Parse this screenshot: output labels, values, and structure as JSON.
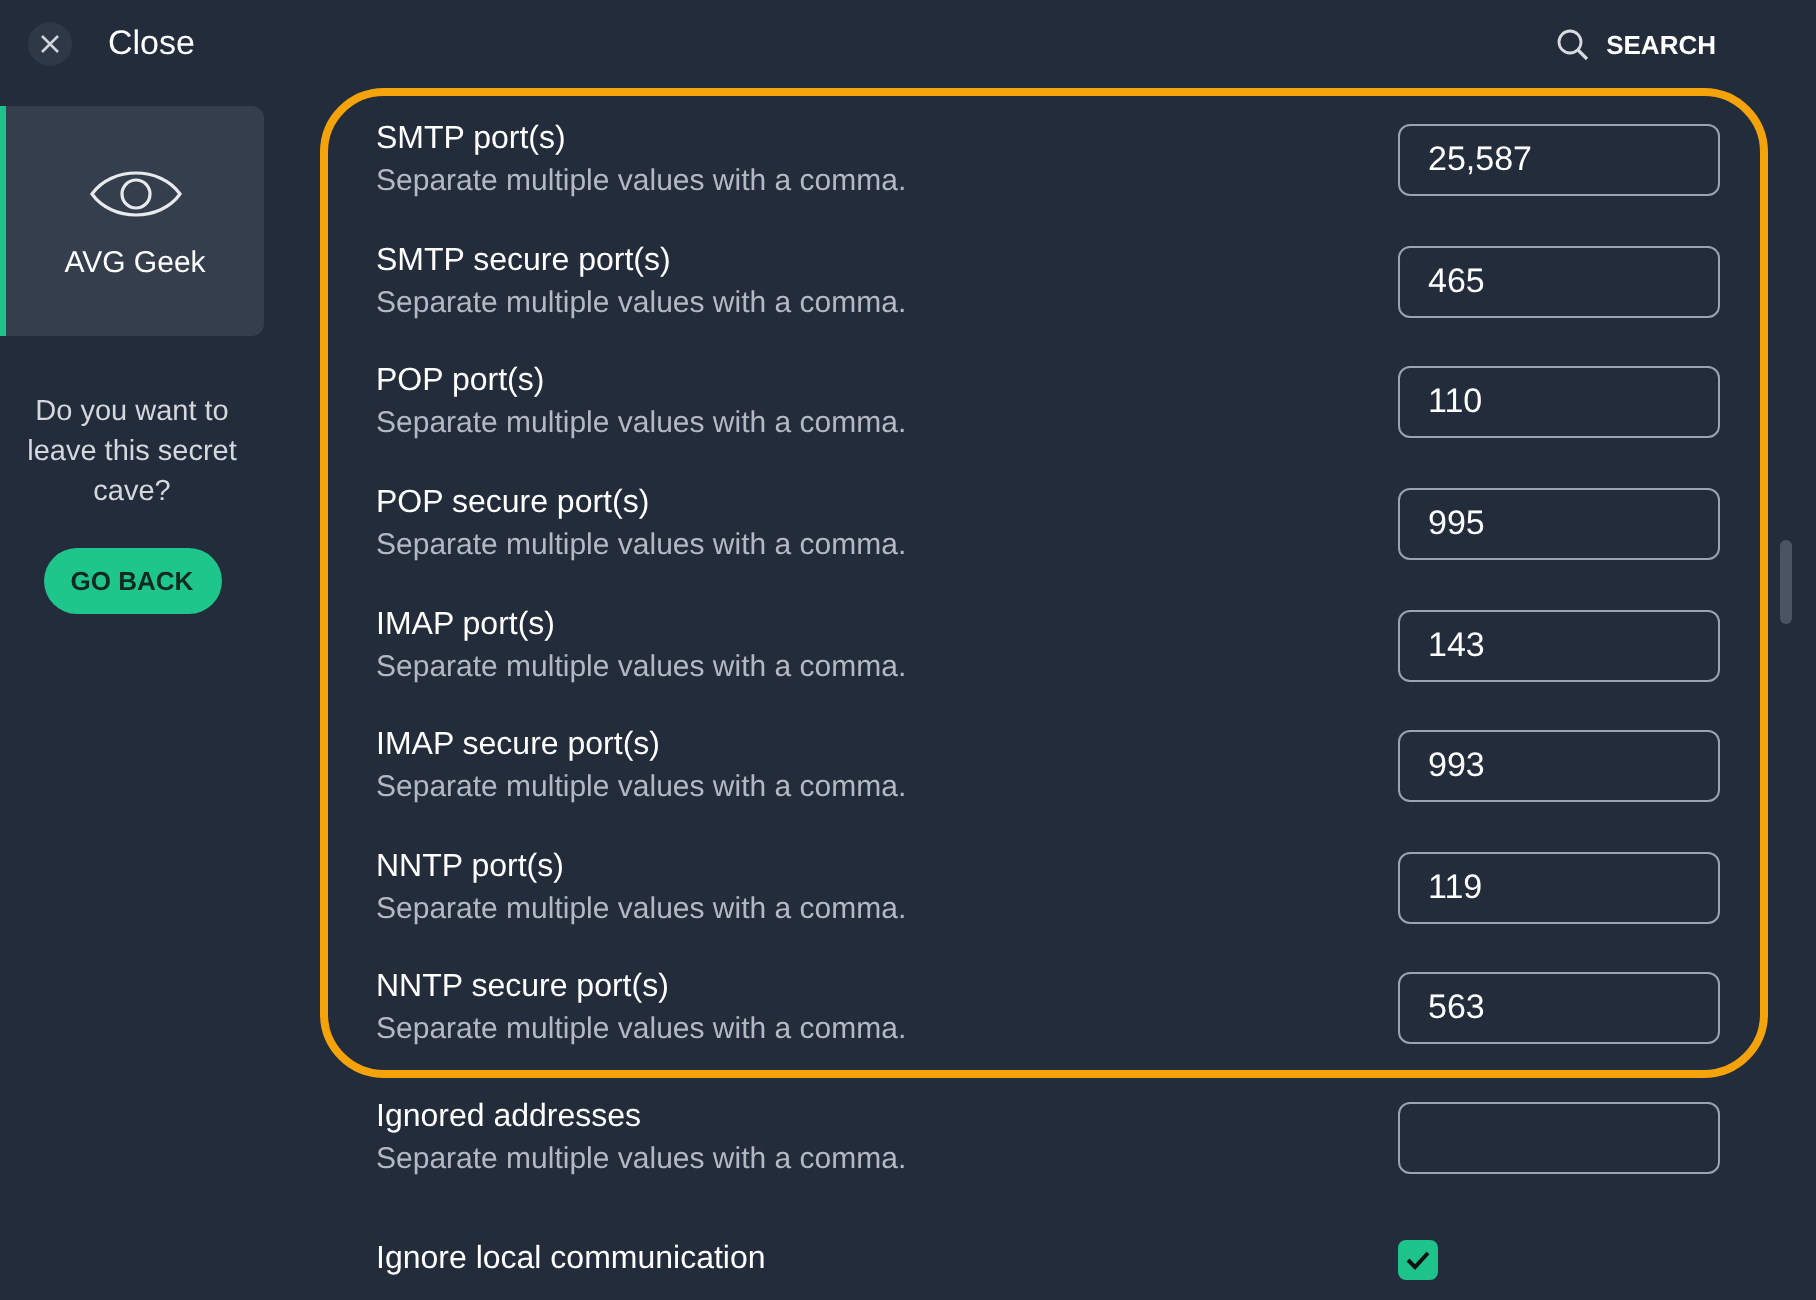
{
  "header": {
    "close_label": "Close",
    "search_label": "SEARCH"
  },
  "sidebar": {
    "items": [
      {
        "label": "AVG Geek",
        "selected": true
      }
    ],
    "prompt": "Do you want to leave this secret cave?",
    "button": "GO BACK"
  },
  "groups": [
    {
      "highlighted": true,
      "rows": [
        {
          "kind": "text",
          "label": "SMTP port(s)",
          "hint": "Separate multiple values with a comma.",
          "value": "25,587"
        },
        {
          "kind": "text",
          "label": "SMTP secure port(s)",
          "hint": "Separate multiple values with a comma.",
          "value": "465"
        },
        {
          "kind": "text",
          "label": "POP port(s)",
          "hint": "Separate multiple values with a comma.",
          "value": "110"
        },
        {
          "kind": "text",
          "label": "POP secure port(s)",
          "hint": "Separate multiple values with a comma.",
          "value": "995"
        },
        {
          "kind": "text",
          "label": "IMAP port(s)",
          "hint": "Separate multiple values with a comma.",
          "value": "143"
        },
        {
          "kind": "text",
          "label": "IMAP secure port(s)",
          "hint": "Separate multiple values with a comma.",
          "value": "993"
        },
        {
          "kind": "text",
          "label": "NNTP port(s)",
          "hint": "Separate multiple values with a comma.",
          "value": "119"
        },
        {
          "kind": "text",
          "label": "NNTP secure port(s)",
          "hint": "Separate multiple values with a comma.",
          "value": "563"
        }
      ]
    },
    {
      "highlighted": false,
      "rows": [
        {
          "kind": "text",
          "label": "Ignored addresses",
          "hint": "Separate multiple values with a comma.",
          "value": ""
        },
        {
          "kind": "checkbox",
          "label": "Ignore local communication",
          "checked": true
        }
      ]
    }
  ]
}
